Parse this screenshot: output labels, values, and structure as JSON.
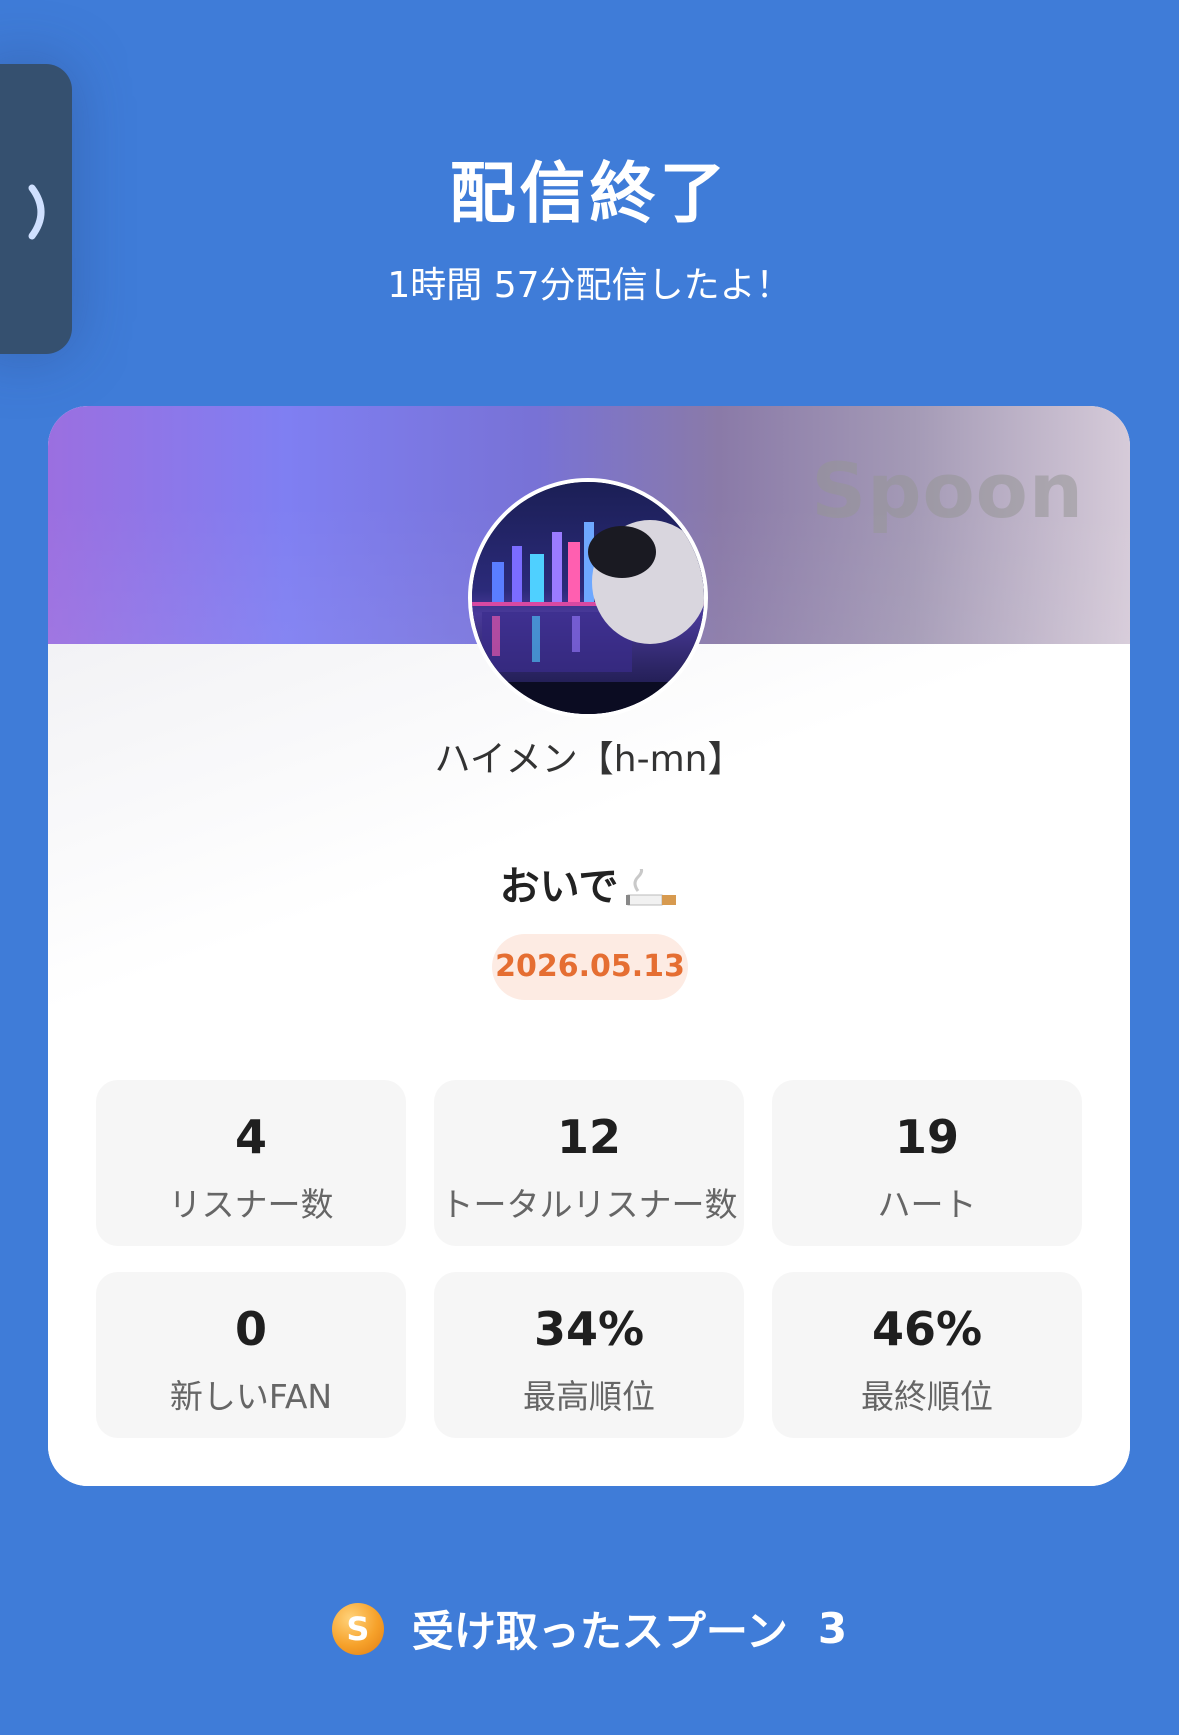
{
  "header": {
    "title": "配信終了",
    "subtitle": "1時間 57分配信したよ！"
  },
  "card": {
    "brand": "Spoon",
    "username": "ハイメン【h-mn】",
    "stream_title": "おいで",
    "stream_title_icon": "cigarette-icon",
    "date": "2026.05.13",
    "stats": [
      {
        "value": "4",
        "label": "リスナー数"
      },
      {
        "value": "12",
        "label": "トータルリスナー数"
      },
      {
        "value": "19",
        "label": "ハート"
      },
      {
        "value": "0",
        "label": "新しいFAN"
      },
      {
        "value": "34%",
        "label": "最高順位"
      },
      {
        "value": "46%",
        "label": "最終順位"
      }
    ]
  },
  "footer": {
    "coin_letter": "S",
    "label": "受け取ったスプーン",
    "count": "3"
  },
  "colors": {
    "background": "#3f7cd8",
    "date_text": "#e56e32",
    "date_bg": "#fdebe3",
    "coin": "#f6a12a"
  }
}
